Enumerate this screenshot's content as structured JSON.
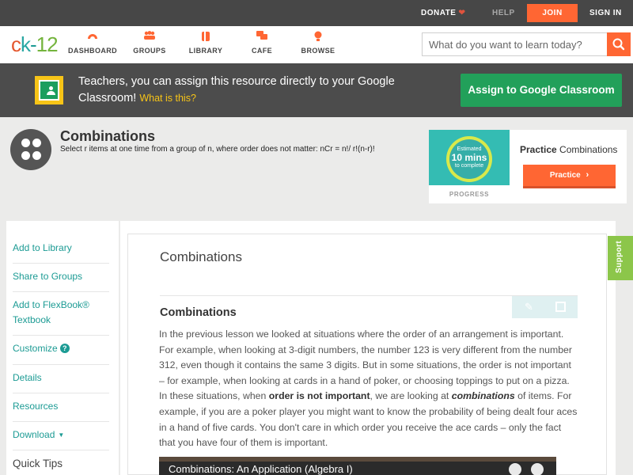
{
  "topbar": {
    "donate": "DONATE",
    "help": "HELP",
    "join": "JOIN",
    "signin": "SIGN IN"
  },
  "nav": {
    "logo": {
      "c": "c",
      "k": "k",
      "dash": "-",
      "num": "12"
    },
    "items": [
      {
        "label": "DASHBOARD",
        "icon": "dashboard-icon"
      },
      {
        "label": "GROUPS",
        "icon": "groups-icon"
      },
      {
        "label": "LIBRARY",
        "icon": "library-icon"
      },
      {
        "label": "CAFE",
        "icon": "cafe-icon"
      },
      {
        "label": "BROWSE",
        "icon": "browse-icon"
      }
    ],
    "search_placeholder": "What do you want to learn today?"
  },
  "google_banner": {
    "text": "Teachers, you can assign this resource directly to your Google Classroom!",
    "link": "What is this?",
    "button": "Assign to Google Classroom"
  },
  "concept": {
    "title": "Combinations",
    "description": "Select r items at one time from a group of n, where order does not matter: nCr = n!/ r!(n-r)!"
  },
  "practice": {
    "estimate_line1": "Estimated",
    "estimate_big": "10 mins",
    "estimate_line3": "to complete",
    "progress_label": "PROGRESS",
    "title_bold": "Practice",
    "title_rest": "Combinations",
    "button": "Practice"
  },
  "sidebar": {
    "items": [
      {
        "label": "Add to Library"
      },
      {
        "label": "Share to Groups"
      },
      {
        "label": "Add to FlexBook® Textbook"
      },
      {
        "label": "Customize"
      },
      {
        "label": "Details"
      },
      {
        "label": "Resources"
      },
      {
        "label": "Download"
      }
    ],
    "quick_tips": "Quick Tips",
    "customize_help": "?"
  },
  "content": {
    "page_title": "Combinations",
    "section_title": "Combinations",
    "para_1": "In the previous lesson we looked at situations where the order of an arrangement is important. For example, when looking at 3-digit numbers, the number 123 is very different from the number 312, even though it contains the same 3 digits. But in some situations, the order is not important – for example, when looking at cards in a hand of poker, or choosing toppings to put on a pizza. In these situations, when ",
    "para_bold": "order is not important",
    "para_2": ", we are looking at ",
    "para_italic": "combinations",
    "para_3": " of items. For example, if you are a poker player you might want to know the probability of being dealt four aces in a hand of five cards. You don't care in which order you receive the ace cards – only the fact that you have four of them is important.",
    "video_title": "Combinations: An Application (Algebra I)"
  },
  "support": "Support",
  "colors": {
    "accent_orange": "#ff6633",
    "teal": "#1c9b94",
    "google_green": "#22a05a",
    "support_green": "#8cc64a"
  }
}
